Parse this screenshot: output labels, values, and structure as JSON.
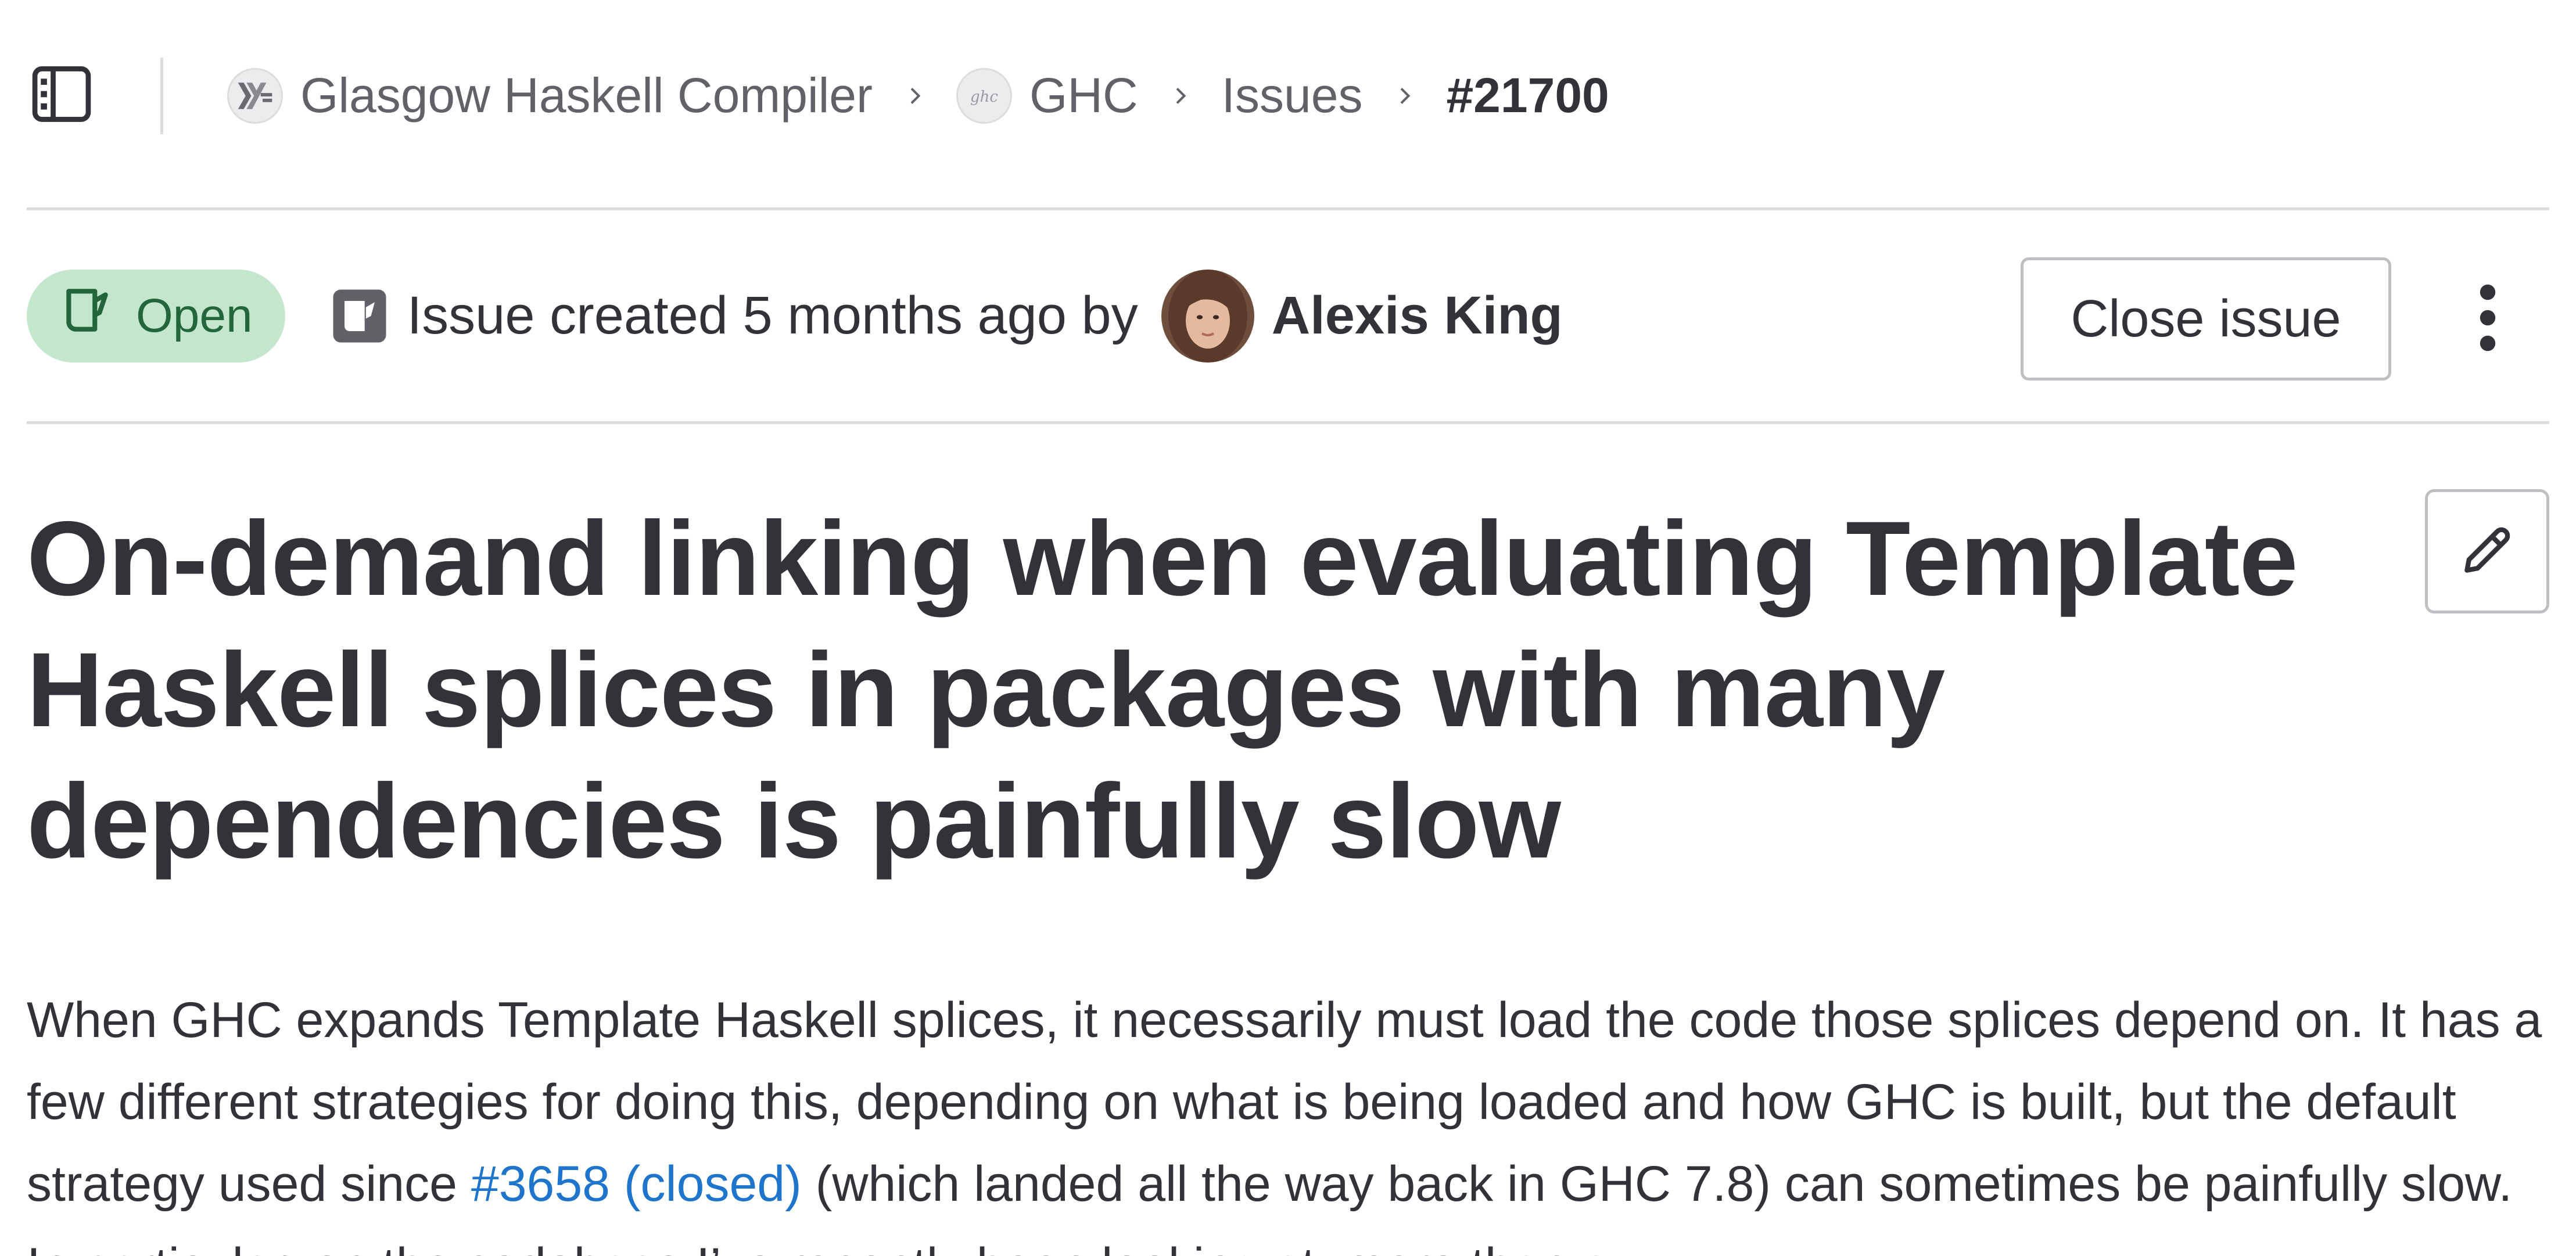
{
  "breadcrumb": {
    "group": "Glasgow Haskell Compiler",
    "project": "GHC",
    "section": "Issues",
    "current": "#21700"
  },
  "issue": {
    "status": "Open",
    "created_text": "Issue created 5 months ago by",
    "author": "Alexis King",
    "close_button": "Close issue",
    "title": "On-demand linking when evaluating Template Haskell splices in packages with many dependencies is painfully slow"
  },
  "description": {
    "line1_before": "When GHC expands Template Haskell splices, it necessarily must load the code those splices depend on. It has a few different strategies for doing this, depending on what is being loaded and how GHC is built, but the default strategy used since ",
    "link_text": "#3658 (closed)",
    "line1_after": " (which landed all the way back in GHC 7.8) can sometimes be painfully slow. In particular, on the codebase I’ve recently been looking at, more than a"
  },
  "colors": {
    "status_bg": "#c3e6cd",
    "status_fg": "#24663b",
    "link": "#1f75cb",
    "text": "#333238",
    "muted": "#626168",
    "border": "#dcdcde"
  },
  "icons": {
    "sidebar": "sidebar-icon",
    "group_avatar": "haskell-logo-icon",
    "project_avatar": "ghc-logo-icon",
    "separator": "chevron-right-icon",
    "status": "issue-open-icon",
    "issue_type": "issue-type-icon",
    "menu": "kebab-menu-icon",
    "edit": "pencil-icon"
  }
}
